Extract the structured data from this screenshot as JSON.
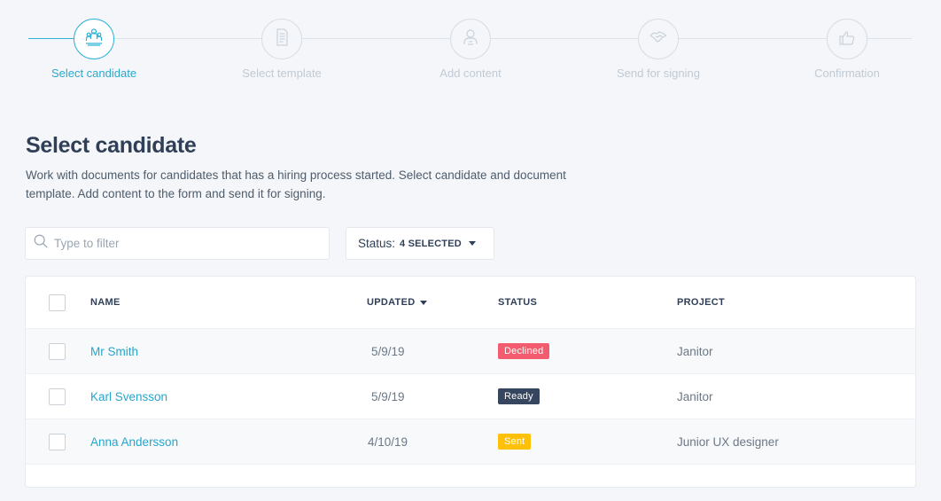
{
  "stepper": {
    "steps": [
      {
        "label": "Select candidate",
        "icon": "candidates-icon",
        "active": true
      },
      {
        "label": "Select template",
        "icon": "document-template-icon",
        "active": false
      },
      {
        "label": "Add content",
        "icon": "person-content-icon",
        "active": false
      },
      {
        "label": "Send for signing",
        "icon": "handshake-icon",
        "active": false
      },
      {
        "label": "Confirmation",
        "icon": "thumbs-up-icon",
        "active": false
      }
    ],
    "accent": "#2eb3d6"
  },
  "page": {
    "title": "Select candidate",
    "description": "Work with documents for candidates that has a hiring process started. Select candidate and document template. Add content to the form and send it for signing."
  },
  "filter": {
    "placeholder": "Type to filter",
    "value": ""
  },
  "status_filter": {
    "label": "Status:",
    "selected": "4 SELECTED"
  },
  "table": {
    "columns": {
      "name": "NAME",
      "updated": "UPDATED",
      "status": "STATUS",
      "project": "PROJECT"
    },
    "rows": [
      {
        "name": "Mr Smith",
        "updated": "5/9/19",
        "status": "Declined",
        "status_color": "#f25c6e",
        "project": "Janitor"
      },
      {
        "name": "Karl Svensson",
        "updated": "5/9/19",
        "status": "Ready",
        "status_color": "#35465e",
        "project": "Janitor"
      },
      {
        "name": "Anna Andersson",
        "updated": "4/10/19",
        "status": "Sent",
        "status_color": "#ffc107",
        "project": "Junior UX designer"
      }
    ]
  }
}
